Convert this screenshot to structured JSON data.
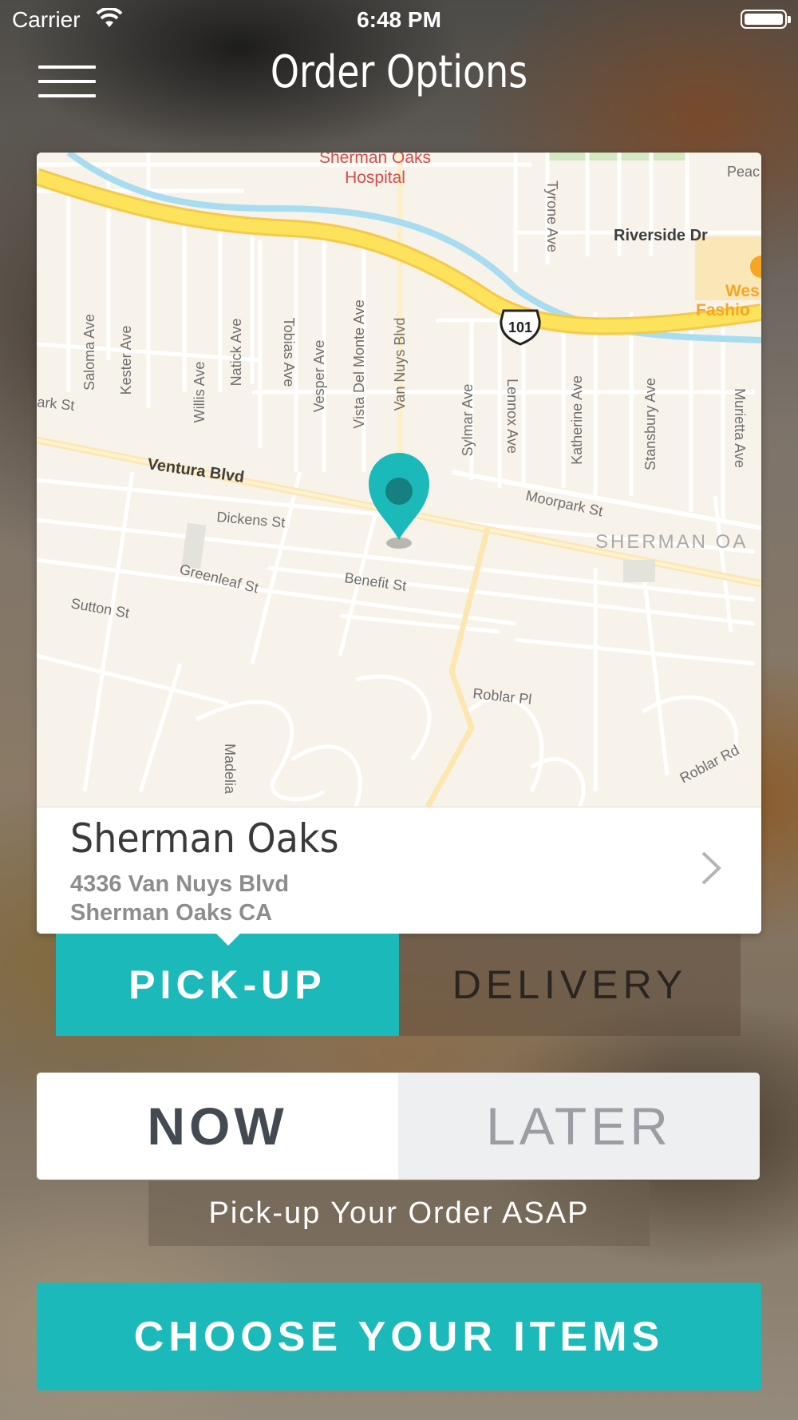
{
  "status_bar": {
    "carrier": "Carrier",
    "time": "6:48 PM"
  },
  "header": {
    "title": "Order Options",
    "menu_icon": "hamburger-menu-icon"
  },
  "map": {
    "streets": {
      "hospital": "Sherman Oaks",
      "hospital_2": "Hospital",
      "peach": "Peac",
      "tyrone": "Tyrone Ave",
      "riverside": "Riverside Dr",
      "westfield": "Wes",
      "fashion": "Fashio",
      "highway": "101",
      "saloma": "Saloma Ave",
      "kester": "Kester Ave",
      "willis": "Willis Ave",
      "natick": "Natick Ave",
      "tobias": "Tobias Ave",
      "vesper": "Vesper Ave",
      "vista": "Vista Del Monte Ave",
      "van_nuys": "Van Nuys Blvd",
      "sylmar": "Sylmar Ave",
      "lennox": "Lennox Ave",
      "katherine": "Katherine Ave",
      "stansbury": "Stansbury Ave",
      "murietta": "Murietta Ave",
      "clark": "ark St",
      "ventura": "Ventura Blvd",
      "moorpark": "Moorpark St",
      "neighborhood": "SHERMAN OA",
      "dickens": "Dickens St",
      "greenleaf": "Greenleaf St",
      "benefit": "Benefit St",
      "sutton": "Sutton St",
      "roblar_pl": "Roblar Pl",
      "roblar_rd": "Roblar Rd",
      "madelia": "Madelia"
    },
    "pin_icon": "map-pin-icon"
  },
  "location": {
    "name": "Sherman Oaks",
    "address_line1": "4336 Van Nuys Blvd",
    "address_line2": "Sherman Oaks CA"
  },
  "fulfillment": {
    "pickup_label": "PICK-UP",
    "delivery_label": "DELIVERY",
    "selected": "pickup"
  },
  "timing": {
    "now_label": "NOW",
    "later_label": "LATER",
    "selected": "now",
    "note": "Pick-up Your Order ASAP"
  },
  "cta": {
    "label": "CHOOSE YOUR ITEMS"
  },
  "colors": {
    "accent": "#1cb9ba",
    "map_background": "#f7f3ea",
    "freeway": "#fddc4a",
    "river": "#a8dcf0"
  }
}
